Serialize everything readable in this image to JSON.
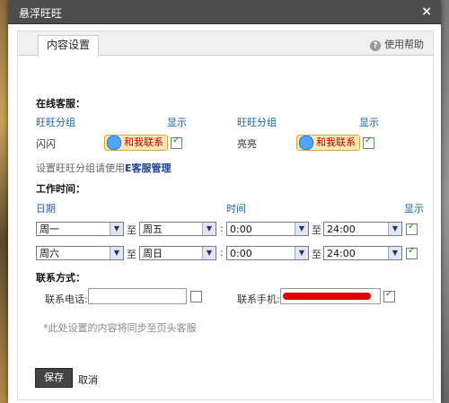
{
  "window": {
    "title": "悬浮旺旺",
    "close_label": "×"
  },
  "tabs": {
    "active": "内容设置",
    "help_label": "使用帮助",
    "help_icon": "?"
  },
  "online": {
    "section_label": "在线客服：",
    "group_header": "旺旺分组",
    "show_header": "显示",
    "rows": [
      {
        "name": "闪闪",
        "button": "和我联系",
        "checked": true
      },
      {
        "name": "亮亮",
        "button": "和我联系",
        "checked": true
      }
    ],
    "note_prefix": "设置旺旺分组请使用",
    "note_link": "E客服管理"
  },
  "worktime": {
    "section_label": "工作时间：",
    "date_header": "日期",
    "time_header": "时间",
    "show_header": "显示",
    "rows": [
      {
        "day_from": "周一",
        "to1": "至",
        "day_to": "周五",
        "colon": ":",
        "time_from": "0:00",
        "to2": "至",
        "time_to": "24:00",
        "checked": true
      },
      {
        "day_from": "周六",
        "to1": "至",
        "day_to": "周日",
        "colon": ":",
        "time_from": "0:00",
        "to2": "至",
        "time_to": "24:00",
        "checked": true
      }
    ]
  },
  "contact": {
    "section_label": "联系方式：",
    "phone_label": "联系电话:",
    "phone_value": "",
    "phone_checked": false,
    "mobile_label": "联系手机:",
    "mobile_checked": true,
    "note": "*此处设置的内容将同步至页头客服"
  },
  "footer": {
    "save_label": "保存",
    "cancel_label": "取消"
  },
  "colors": {
    "accent_blue": "#1f5fa8",
    "titlebar": "#4d4d4d",
    "note_red": "#d00000"
  }
}
